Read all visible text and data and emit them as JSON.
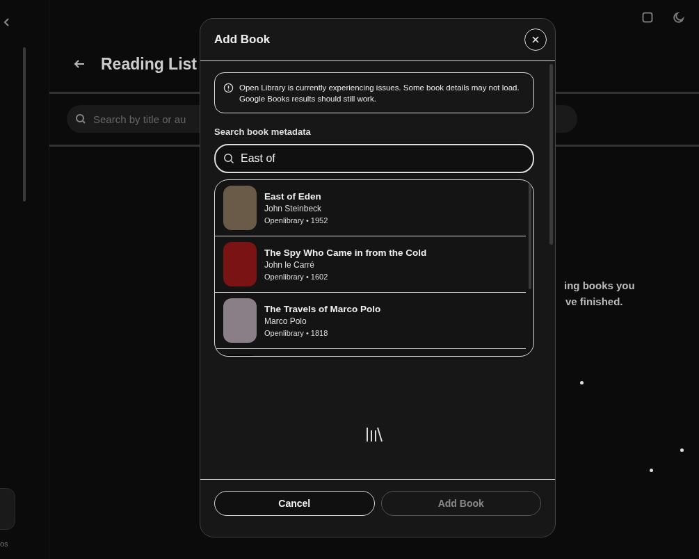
{
  "page": {
    "title": "Reading List",
    "search": {
      "placeholder": "Search by title or au"
    },
    "empty_state_fragments": [
      "ing books you",
      "ve finished."
    ],
    "sidebar_label": "os"
  },
  "dialog": {
    "title": "Add Book",
    "alert": "Open Library is currently experiencing issues. Some book details may not load. Google Books results should still work.",
    "search_label": "Search book metadata",
    "search": {
      "value": "East of "
    },
    "results": [
      {
        "title": "East of Eden",
        "author": "John Steinbeck",
        "meta": "Openlibrary • 1952"
      },
      {
        "title": "The Spy Who Came in from the Cold",
        "author": "John le Carré",
        "meta": "Openlibrary • 1602"
      },
      {
        "title": "The Travels of Marco Polo",
        "author": "Marco Polo",
        "meta": "Openlibrary • 1818"
      }
    ],
    "buttons": [
      {
        "label": "Cancel",
        "disabled": false
      },
      {
        "label": "Add Book",
        "disabled": true
      }
    ]
  }
}
